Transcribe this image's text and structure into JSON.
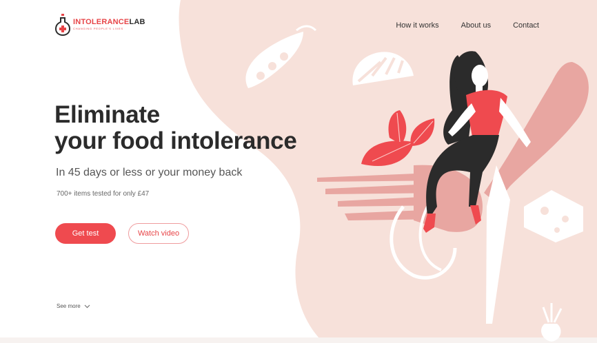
{
  "brand": {
    "name_red": "INTOLERANCE",
    "name_dark": "LAB",
    "tagline": "CHANGING PEOPLE'S LIVES",
    "accent_color": "#ef4a4f",
    "background_color": "#f7e1da"
  },
  "nav": {
    "items": [
      {
        "label": "How it works"
      },
      {
        "label": "About us"
      },
      {
        "label": "Contact"
      }
    ]
  },
  "hero": {
    "title_line1": "Eliminate",
    "title_line2": "your food intolerance",
    "subtitle": "In 45 days or less or your money back",
    "tested": "700+ items tested for only £47",
    "primary_button": "Get test",
    "secondary_button": "Watch video",
    "see_more": "See more"
  },
  "icons": {
    "logo": "flask-icon",
    "see_more": "chevron-down-icon"
  }
}
